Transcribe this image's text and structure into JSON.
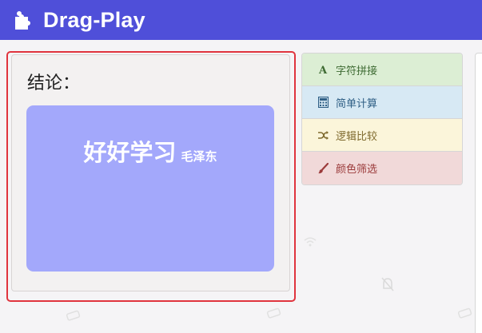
{
  "header": {
    "title": "Drag-Play",
    "logo_icon": "puzzle-icon",
    "background": "#4f4fd9"
  },
  "conclusion": {
    "title": "结论：",
    "result_text": "好好学习",
    "result_author": "毛泽东",
    "card_color": "#a3a8fb",
    "highlight_color": "#e0343e"
  },
  "categories": [
    {
      "label": "字符拼接",
      "icon": "font-a-icon",
      "color": "#dceed4"
    },
    {
      "label": "简单计算",
      "icon": "calculator-icon",
      "color": "#d7e9f4"
    },
    {
      "label": "逻辑比较",
      "icon": "shuffle-icon",
      "color": "#fbf5da"
    },
    {
      "label": "颜色筛选",
      "icon": "paint-brush-icon",
      "color": "#f1d9d9"
    }
  ]
}
